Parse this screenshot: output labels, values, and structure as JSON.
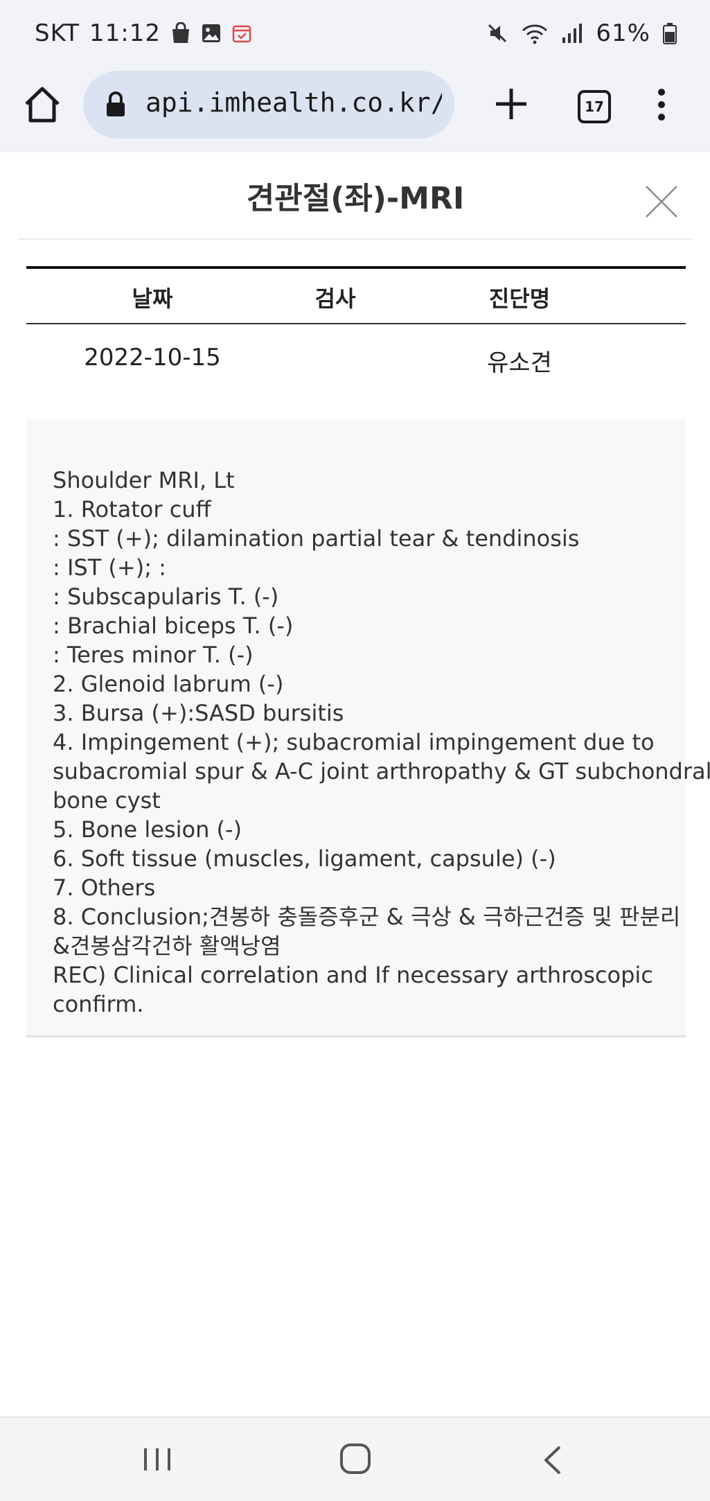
{
  "status_bar": {
    "carrier": "SKT",
    "time": "11:12",
    "battery": "61%",
    "left_icons": [
      "shopping-bag-icon",
      "gallery-icon",
      "calendar-icon"
    ],
    "right_icons": [
      "mute-icon",
      "wifi-icon",
      "signal-icon",
      "battery-icon"
    ]
  },
  "browser": {
    "url": "api.imhealth.co.kr/App",
    "tab_count": "17"
  },
  "modal": {
    "title": "견관절(좌)-MRI"
  },
  "table": {
    "headers": [
      "날짜",
      "검사",
      "진단명"
    ],
    "row": {
      "date": "2022-10-15",
      "exam": "",
      "diagnosis": "유소견"
    }
  },
  "report": {
    "lines": [
      "Shoulder MRI, Lt",
      "1. Rotator cuff",
      ": SST (+); dilamination partial tear & tendinosis",
      ": IST (+); :",
      ": Subscapularis T. (-)",
      ": Brachial biceps T. (-)",
      ": Teres minor T. (-)",
      "2. Glenoid labrum (-)",
      "3. Bursa (+):SASD bursitis",
      "4. Impingement (+); subacromial impingement due to",
      "subacromial spur & A-C joint arthropathy & GT subchondral",
      "bone cyst",
      "5. Bone lesion (-)",
      "6. Soft tissue (muscles, ligament, capsule) (-)",
      "7. Others",
      "8. Conclusion;견봉하 충돌증후군 & 극상 & 극하근건증 및 판분리",
      "&견봉삼각건하 활액낭염",
      "REC) Clinical correlation and If necessary arthroscopic",
      "confirm."
    ]
  },
  "colors": {
    "chrome_bg": "#f1f3f8",
    "url_pill": "#dbe3f2",
    "report_bg": "#f8f8f8"
  }
}
